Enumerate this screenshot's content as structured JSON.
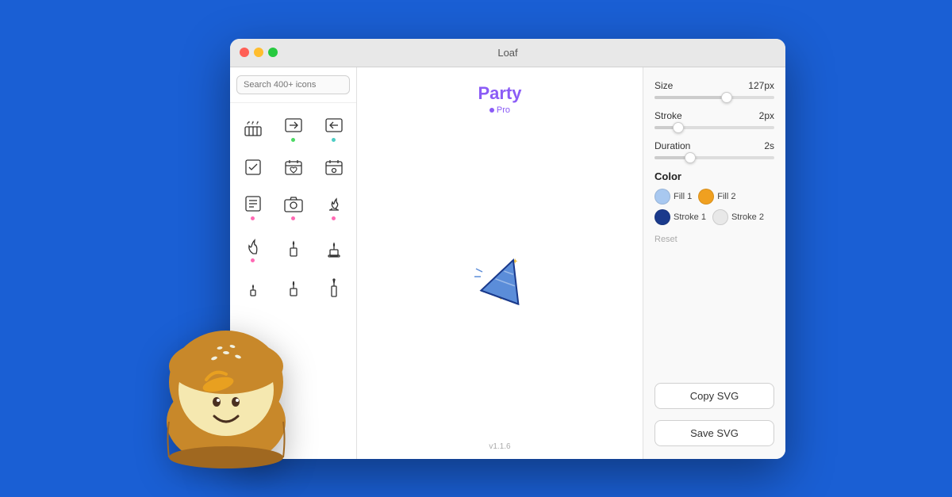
{
  "window": {
    "title": "Loaf",
    "traffic_lights": [
      "red",
      "yellow",
      "green"
    ]
  },
  "sidebar": {
    "search_placeholder": "Search 400+ icons",
    "icons": [
      {
        "id": "birthday-cake",
        "dot": "none"
      },
      {
        "id": "arrow-right",
        "dot": "green"
      },
      {
        "id": "arrow-left",
        "dot": "teal"
      },
      {
        "id": "checkbox",
        "dot": "none"
      },
      {
        "id": "heart-calendar",
        "dot": "none"
      },
      {
        "id": "settings-calendar",
        "dot": "none"
      },
      {
        "id": "notes",
        "dot": "pink"
      },
      {
        "id": "camera",
        "dot": "pink"
      },
      {
        "id": "campfire",
        "dot": "pink"
      },
      {
        "id": "flame",
        "dot": "pink"
      },
      {
        "id": "candle-1",
        "dot": "pink"
      },
      {
        "id": "candle-2",
        "dot": "none"
      },
      {
        "id": "candle-small",
        "dot": "none"
      },
      {
        "id": "candle-medium",
        "dot": "none"
      },
      {
        "id": "candle-tall",
        "dot": "none"
      }
    ]
  },
  "main": {
    "icon_name": "Party",
    "pro_label": "Pro",
    "version": "v1.1.6"
  },
  "right_panel": {
    "size_label": "Size",
    "size_value": "127px",
    "size_pct": 60,
    "stroke_label": "Stroke",
    "stroke_value": "2px",
    "stroke_pct": 20,
    "duration_label": "Duration",
    "duration_value": "2s",
    "duration_pct": 30,
    "color_section": "Color",
    "fill1_label": "Fill 1",
    "fill1_color": "#a8c8f0",
    "fill2_label": "Fill 2",
    "fill2_color": "#f0a020",
    "stroke1_label": "Stroke 1",
    "stroke1_color": "#1a3a8c",
    "stroke2_label": "Stroke 2",
    "stroke2_color": "#e8e8e8",
    "reset_label": "Reset",
    "copy_svg_label": "Copy SVG",
    "save_svg_label": "Save SVG"
  }
}
